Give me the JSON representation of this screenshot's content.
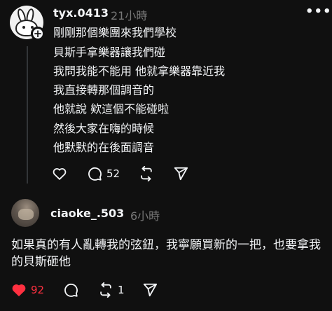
{
  "post1": {
    "username": "tyx.0413",
    "time": "21小時",
    "more": "•••",
    "lines": [
      "剛剛那個樂團來我們學校",
      "貝斯手拿樂器讓我們碰",
      "我問我能不能用 他就拿樂器靠近我",
      "我直接轉那個調音的",
      "他就說 欸這個不能碰啦",
      "然後大家在嗨的時候",
      "他默默的在後面調音"
    ],
    "actions": {
      "like_icon": "heart-outline-icon",
      "comment_icon": "speech-bubble-icon",
      "comment_count": "52",
      "repost_icon": "repost-icon",
      "share_icon": "send-icon"
    }
  },
  "post2": {
    "username": "ciaoke_.503",
    "time": "6小時",
    "text": "如果真的有人亂轉我的弦鈕，我寧願買新的一把，也要拿我的貝斯砸他",
    "actions": {
      "like_icon": "heart-filled-icon",
      "like_count": "92",
      "comment_icon": "speech-bubble-icon",
      "repost_icon": "repost-icon",
      "repost_count": "1",
      "share_icon": "send-icon"
    }
  },
  "colors": {
    "background": "#101010",
    "text": "#f3f5f7",
    "muted": "#777777",
    "liked": "#ff3040"
  }
}
